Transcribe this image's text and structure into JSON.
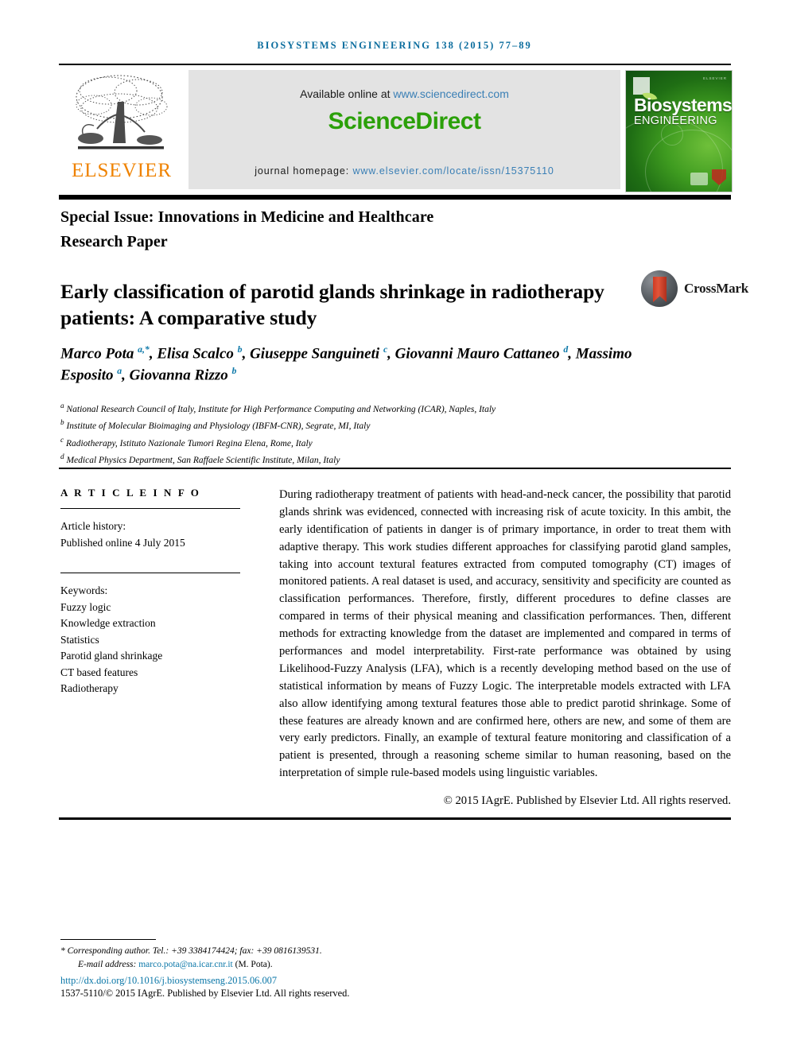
{
  "running_head": "BIOSYSTEMS ENGINEERING 138 (2015) 77–89",
  "masthead": {
    "publisher_logo_text": "ELSEVIER",
    "publisher_logo_icon": "elsevier-tree-icon",
    "available_prefix": "Available online at ",
    "available_link": "www.sciencedirect.com",
    "sciencedirect_logo": "ScienceDirect",
    "homepage_prefix": "journal homepage: ",
    "homepage_link": "www.elsevier.com/locate/issn/15375110",
    "cover": {
      "title_line1": "Biosystems",
      "title_line2": "ENGINEERING",
      "corner_text": "ELSEVIER"
    },
    "colors": {
      "banner_bg": "#e3e3e3",
      "sciencedirect_green": "#2ba009",
      "link_blue": "#3a7fb5",
      "elsevier_orange": "#ef8200",
      "running_head_blue": "#0b6d9e"
    }
  },
  "headers": {
    "special_issue": "Special Issue: Innovations in Medicine and Healthcare",
    "article_type": "Research Paper"
  },
  "title": "Early classification of parotid glands shrinkage in radiotherapy patients: A comparative study",
  "crossmark": {
    "label": "CrossMark",
    "icon": "crossmark-icon"
  },
  "authors": [
    {
      "name": "Marco Pota",
      "sup": "a",
      "star": true
    },
    {
      "name": "Elisa Scalco",
      "sup": "b",
      "star": false
    },
    {
      "name": "Giuseppe Sanguineti",
      "sup": "c",
      "star": false
    },
    {
      "name": "Giovanni Mauro Cattaneo",
      "sup": "d",
      "star": false
    },
    {
      "name": "Massimo Esposito",
      "sup": "a",
      "star": false
    },
    {
      "name": "Giovanna Rizzo",
      "sup": "b",
      "star": false
    }
  ],
  "affiliations": [
    {
      "mark": "a",
      "text": "National Research Council of Italy, Institute for High Performance Computing and Networking (ICAR), Naples, Italy"
    },
    {
      "mark": "b",
      "text": "Institute of Molecular Bioimaging and Physiology (IBFM-CNR), Segrate, MI, Italy"
    },
    {
      "mark": "c",
      "text": "Radiotherapy, Istituto Nazionale Tumori Regina Elena, Rome, Italy"
    },
    {
      "mark": "d",
      "text": "Medical Physics Department, San Raffaele Scientific Institute, Milan, Italy"
    }
  ],
  "article_info": {
    "heading": "A R T I C L E  I N F O",
    "history_label": "Article history:",
    "history_value": "Published online 4 July 2015",
    "keywords_label": "Keywords:",
    "keywords": [
      "Fuzzy logic",
      "Knowledge extraction",
      "Statistics",
      "Parotid gland shrinkage",
      "CT based features",
      "Radiotherapy"
    ]
  },
  "abstract": {
    "text": "During radiotherapy treatment of patients with head-and-neck cancer, the possibility that parotid glands shrink was evidenced, connected with increasing risk of acute toxicity. In this ambit, the early identification of patients in danger is of primary importance, in order to treat them with adaptive therapy. This work studies different approaches for classifying parotid gland samples, taking into account textural features extracted from computed tomography (CT) images of monitored patients. A real dataset is used, and accuracy, sensitivity and specificity are counted as classification performances. Therefore, firstly, different procedures to define classes are compared in terms of their physical meaning and classification performances. Then, different methods for extracting knowledge from the dataset are implemented and compared in terms of performances and model interpretability. First-rate performance was obtained by using Likelihood-Fuzzy Analysis (LFA), which is a recently developing method based on the use of statistical information by means of Fuzzy Logic. The interpretable models extracted with LFA also allow identifying among textural features those able to predict parotid shrinkage. Some of these features are already known and are confirmed here, others are new, and some of them are very early predictors. Finally, an example of textural feature monitoring and classification of a patient is presented, through a reasoning scheme similar to human reasoning, based on the interpretation of simple rule-based models using linguistic variables.",
    "copyright": "© 2015 IAgrE. Published by Elsevier Ltd. All rights reserved."
  },
  "footer": {
    "corresponding": "* Corresponding author. Tel.: +39 3384174424; fax: +39 0816139531.",
    "email_label": "E-mail address: ",
    "email": "marco.pota@na.icar.cnr.it",
    "email_suffix": " (M. Pota).",
    "doi": "http://dx.doi.org/10.1016/j.biosystemseng.2015.06.007",
    "issn_line": "1537-5110/© 2015 IAgrE. Published by Elsevier Ltd. All rights reserved."
  }
}
